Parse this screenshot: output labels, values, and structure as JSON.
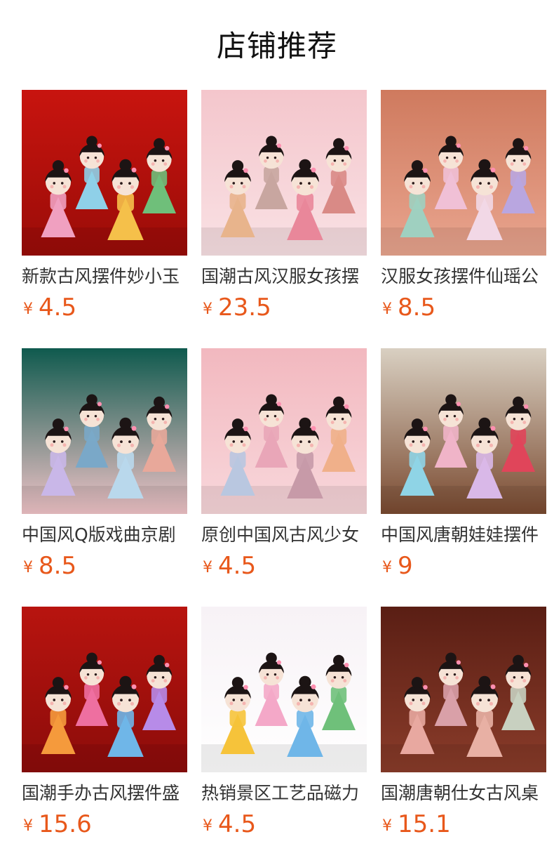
{
  "header": {
    "title": "店铺推荐"
  },
  "currency_symbol": "¥",
  "colors": {
    "price": "#e8581b",
    "title": "#111111",
    "name": "#333333"
  },
  "products": [
    {
      "name": "新款古风摆件妙小玉",
      "price": "4.5",
      "image": "four-chibi-hanfu-figurines-red-background",
      "bg": "#c8140f",
      "bg2": "#9a0c08",
      "dolls": [
        "#f0a0c0",
        "#8fd0e8",
        "#f5c04a",
        "#6fbf7a"
      ]
    },
    {
      "name": "国潮古风汉服女孩摆",
      "price": "23.5",
      "image": "four-hanfu-girls-with-flower-baskets-pink",
      "bg": "#f4c6cc",
      "bg2": "#f9e1e4",
      "dolls": [
        "#e8b48c",
        "#c8a6a0",
        "#e9879a",
        "#d98a86"
      ]
    },
    {
      "name": "汉服女孩摆件仙瑶公",
      "price": "8.5",
      "image": "hanfu-girls-on-pedestals-salmon-background",
      "bg": "#cf7a5e",
      "bg2": "#e9a58f",
      "dolls": [
        "#9fd0c0",
        "#f0c0d6",
        "#f2d8e6",
        "#b9a6e0"
      ]
    },
    {
      "name": "中国风Q版戏曲京剧",
      "price": "8.5",
      "image": "peking-opera-chibi-figurines-teal-background",
      "bg": "#0f5a4e",
      "bg2": "#f1c4c8",
      "dolls": [
        "#c9b7e8",
        "#7aa8c8",
        "#b9d8ec",
        "#e8a89a"
      ]
    },
    {
      "name": "原创中国风古风少女",
      "price": "4.5",
      "image": "hanfu-maiden-figurines-pink-arch",
      "bg": "#f2b8bf",
      "bg2": "#f8d7db",
      "dolls": [
        "#b9c7e0",
        "#e9a6b8",
        "#c79aa8",
        "#f0b08a"
      ]
    },
    {
      "name": "中国风唐朝娃娃摆件",
      "price": "9",
      "image": "tang-dynasty-doll-figurines-ink-painting-background",
      "bg": "#d9d0c2",
      "bg2": "#7a4a30",
      "dolls": [
        "#8fd4e6",
        "#f0b4c8",
        "#d9b8e8",
        "#e0455a"
      ]
    },
    {
      "name": "国潮手办古风摆件盛",
      "price": "15.6",
      "image": "colorful-gradient-hanfu-figurines-red-background",
      "bg": "#b8140f",
      "bg2": "#8c0c0a",
      "dolls": [
        "#f59a3c",
        "#ee6fa0",
        "#6fb6e8",
        "#b78be8"
      ]
    },
    {
      "name": "热销景区工艺品磁力",
      "price": "4.5",
      "image": "chibi-fridge-magnets-white-background",
      "bg": "#f7f2f6",
      "bg2": "#ffffff",
      "dolls": [
        "#f6c33a",
        "#f4a8c8",
        "#6fb6e8",
        "#6fc07a"
      ]
    },
    {
      "name": "国潮唐朝仕女古风桌",
      "price": "15.1",
      "image": "tang-ladies-playing-guqin-wooden-screen",
      "bg": "#5a1e14",
      "bg2": "#8a3c2a",
      "dolls": [
        "#e8a8a0",
        "#d9a0a8",
        "#e8b0a4",
        "#c8d0c0"
      ]
    }
  ]
}
